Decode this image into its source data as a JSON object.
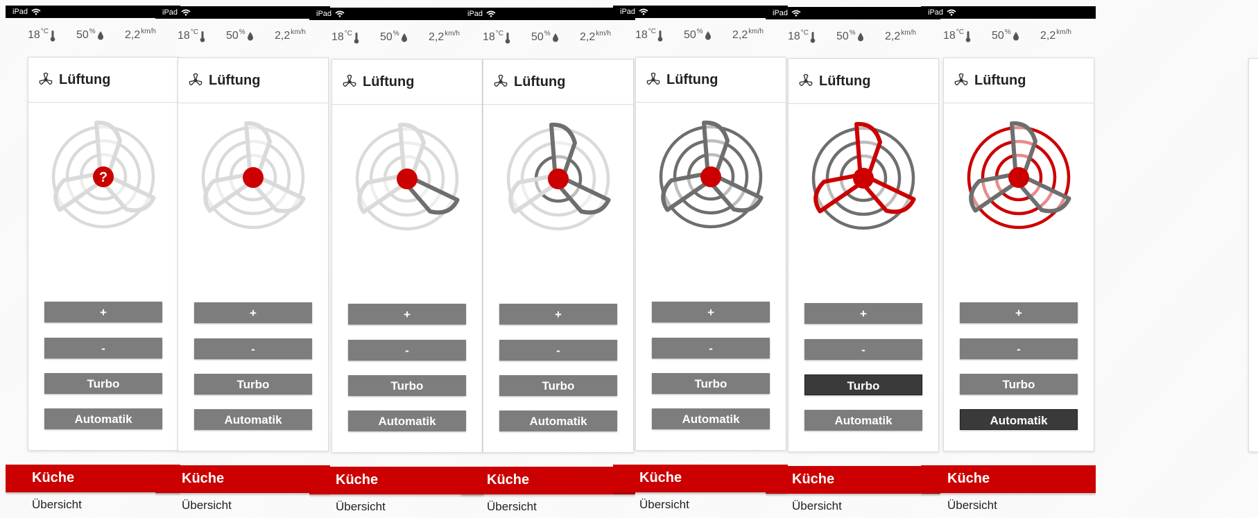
{
  "status_bar": {
    "device": "iPad",
    "wifi_icon": "wifi-icon"
  },
  "weather": {
    "temperature": "18",
    "temperature_unit": "°C",
    "humidity": "50",
    "humidity_unit": "%",
    "wind": "2,2",
    "wind_unit": "km/h"
  },
  "colors": {
    "accent": "#cc0000",
    "button": "#7d7d7d",
    "button_active": "#3a3a3a",
    "fan_off": "#dadada",
    "fan_on": "#6e6e6e"
  },
  "panels": [
    {
      "title": "Lüftung",
      "state": "unknown",
      "level_badge": "?",
      "plus": "+",
      "minus": "-",
      "turbo": "Turbo",
      "automatik": "Automatik",
      "room": "Küche",
      "nav": "Übersicht"
    },
    {
      "title": "Lüftung",
      "state": "level-0",
      "plus": "+",
      "minus": "-",
      "turbo": "Turbo",
      "automatik": "Automatik",
      "room": "Küche",
      "nav": "Übersicht"
    },
    {
      "title": "Lüftung",
      "state": "level-1",
      "plus": "+",
      "minus": "-",
      "turbo": "Turbo",
      "automatik": "Automatik",
      "room": "Küche",
      "nav": "Übersicht"
    },
    {
      "title": "Lüftung",
      "state": "level-2",
      "plus": "+",
      "minus": "-",
      "turbo": "Turbo",
      "automatik": "Automatik",
      "room": "Küche",
      "nav": "Übersicht"
    },
    {
      "title": "Lüftung",
      "state": "level-3",
      "plus": "+",
      "minus": "-",
      "turbo": "Turbo",
      "automatik": "Automatik",
      "room": "Küche",
      "nav": "Übersicht"
    },
    {
      "title": "Lüftung",
      "state": "turbo",
      "active_button": "turbo",
      "plus": "+",
      "minus": "-",
      "turbo": "Turbo",
      "automatik": "Automatik",
      "room": "Küche",
      "nav": "Übersicht"
    },
    {
      "title": "Lüftung",
      "state": "automatik",
      "active_button": "automatik",
      "plus": "+",
      "minus": "-",
      "turbo": "Turbo",
      "automatik": "Automatik",
      "room": "Küche",
      "nav": "Übersicht"
    }
  ]
}
